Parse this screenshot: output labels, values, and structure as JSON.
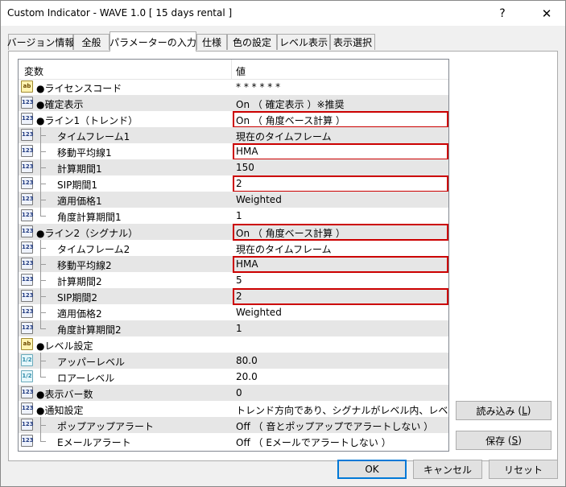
{
  "window": {
    "title": "Custom Indicator - WAVE 1.0 [ 15 days rental ]",
    "help_label": "?",
    "close_label": "✕"
  },
  "tabs": [
    {
      "label": "バージョン情報"
    },
    {
      "label": "全般"
    },
    {
      "label": "パラメーターの入力",
      "active": true
    },
    {
      "label": "仕様"
    },
    {
      "label": "色の設定"
    },
    {
      "label": "レベル表示"
    },
    {
      "label": "表示選択"
    }
  ],
  "table": {
    "headers": {
      "variable": "変数",
      "value": "値"
    },
    "rows": [
      {
        "icon": "ab",
        "name": "●ライセンスコード",
        "value": "* * * * * *"
      },
      {
        "icon": "123",
        "name": "●確定表示",
        "value": "On （ 確定表示 ）※推奨"
      },
      {
        "icon": "123",
        "name": "●ライン1（トレンド）",
        "value": "On （ 角度ベース計算 ）",
        "highlight": true
      },
      {
        "icon": "123",
        "name": "タイムフレーム1",
        "value": "現在のタイムフレーム"
      },
      {
        "icon": "123",
        "name": "移動平均線1",
        "value": "HMA",
        "highlight": true
      },
      {
        "icon": "123",
        "name": "計算期間1",
        "value": "150"
      },
      {
        "icon": "123",
        "name": "SIP期間1",
        "value": "2",
        "highlight": true
      },
      {
        "icon": "123",
        "name": "適用価格1",
        "value": "Weighted"
      },
      {
        "icon": "123",
        "name": "角度計算期間1",
        "value": "1"
      },
      {
        "icon": "123",
        "name": "●ライン2（シグナル）",
        "value": "On （ 角度ベース計算 ）",
        "highlight": true
      },
      {
        "icon": "123",
        "name": "タイムフレーム2",
        "value": "現在のタイムフレーム"
      },
      {
        "icon": "123",
        "name": "移動平均線2",
        "value": "HMA",
        "highlight": true
      },
      {
        "icon": "123",
        "name": "計算期間2",
        "value": "5"
      },
      {
        "icon": "123",
        "name": "SIP期間2",
        "value": "2",
        "highlight": true
      },
      {
        "icon": "123",
        "name": "適用価格2",
        "value": "Weighted"
      },
      {
        "icon": "123",
        "name": "角度計算期間2",
        "value": "1"
      },
      {
        "icon": "ab",
        "name": "●レベル設定",
        "value": ""
      },
      {
        "icon": "1/2",
        "name": "アッパーレベル",
        "value": "80.0"
      },
      {
        "icon": "1/2",
        "name": "ロアーレベル",
        "value": "20.0"
      },
      {
        "icon": "123",
        "name": "●表示バー数",
        "value": "0"
      },
      {
        "icon": "123",
        "name": "●通知設定",
        "value": "トレンド方向であり、シグナルがレベル内、レベル外に･.."
      },
      {
        "icon": "123",
        "name": "ポップアップアラート",
        "value": "Off （ 音とポップアップでアラートしない ）"
      },
      {
        "icon": "123",
        "name": "Eメールアラート",
        "value": "Off （ Eメールでアラートしない ）"
      }
    ]
  },
  "side_buttons": {
    "load_label": "読み込み",
    "load_key": "L",
    "save_label": "保存",
    "save_key": "S"
  },
  "bottom_buttons": {
    "ok_label": "OK",
    "cancel_label": "キャンセル",
    "reset_label": "リセット"
  }
}
